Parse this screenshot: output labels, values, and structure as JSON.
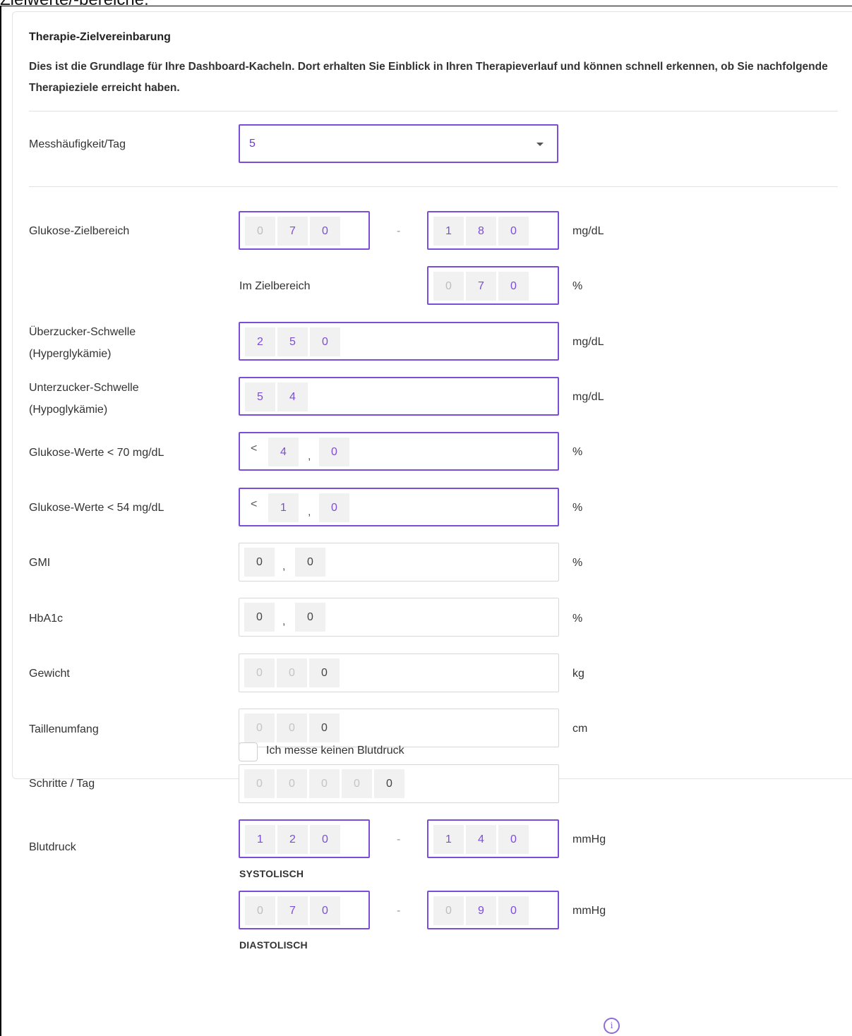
{
  "top_heading": "Zielwerte/-bereiche:",
  "form": {
    "title": "Therapie-Zielvereinbarung",
    "intro": "Dies ist die Grundlage für Ihre Dashboard-Kacheln. Dort erhalten Sie Einblick in Ihren Therapieverlauf und können schnell erkennen, ob Sie nachfolgende Therapieziele erreicht haben.",
    "frequency": {
      "label": "Messhäufigkeit/Tag",
      "value": "5"
    },
    "glucose_range": {
      "label": "Glukose-Zielbereich",
      "from": [
        "0",
        "7",
        "0"
      ],
      "dash": "-",
      "to": [
        "1",
        "8",
        "0"
      ],
      "unit": "mg/dL"
    },
    "in_range": {
      "label": "Im Zielbereich",
      "digits": [
        "0",
        "7",
        "0"
      ],
      "unit": "%"
    },
    "hyper": {
      "label_line1": "Überzucker-Schwelle",
      "label_line2": "(Hyperglykämie)",
      "digits": [
        "2",
        "5",
        "0"
      ],
      "unit": "mg/dL"
    },
    "hypo": {
      "label_line1": "Unterzucker-Schwelle",
      "label_line2": "(Hypoglykämie)",
      "digits": [
        "5",
        "4"
      ],
      "unit": "mg/dL"
    },
    "below70": {
      "label": "Glukose-Werte < 70 mg/dL",
      "prefix": "<",
      "int": "4",
      "sep": ",",
      "dec": "0",
      "unit": "%"
    },
    "below54": {
      "label": "Glukose-Werte < 54 mg/dL",
      "prefix": "<",
      "int": "1",
      "sep": ",",
      "dec": "0",
      "unit": "%"
    },
    "gmi": {
      "label": "GMI",
      "int": "0",
      "sep": ",",
      "dec": "0",
      "unit": "%"
    },
    "hba1c": {
      "label": "HbA1c",
      "int": "0",
      "sep": ",",
      "dec": "0",
      "unit": "%"
    },
    "weight": {
      "label": "Gewicht",
      "digits": [
        "0",
        "0",
        "0"
      ],
      "unit": "kg"
    },
    "waist": {
      "label": "Taillenumfang",
      "digits": [
        "0",
        "0",
        "0"
      ],
      "unit": "cm"
    },
    "steps": {
      "label": "Schritte / Tag",
      "digits": [
        "0",
        "0",
        "0",
        "0",
        "0"
      ]
    },
    "blood_pressure": {
      "label": "Blutdruck",
      "systolic": {
        "from": [
          "1",
          "2",
          "0"
        ],
        "to": [
          "1",
          "4",
          "0"
        ],
        "caption": "SYSTOLISCH",
        "unit": "mmHg"
      },
      "diastolic": {
        "from": [
          "0",
          "7",
          "0"
        ],
        "to": [
          "0",
          "9",
          "0"
        ],
        "caption": "DIASTOLISCH",
        "unit": "mmHg"
      },
      "dash": "-"
    },
    "no_bp_checkbox": {
      "label": "Ich messe keinen Blutdruck",
      "checked": false
    }
  },
  "info_icon": "i",
  "colors": {
    "accent": "#7c4dd8",
    "cell_bg": "#f1f1f1",
    "placeholder": "#bdbdbd"
  }
}
